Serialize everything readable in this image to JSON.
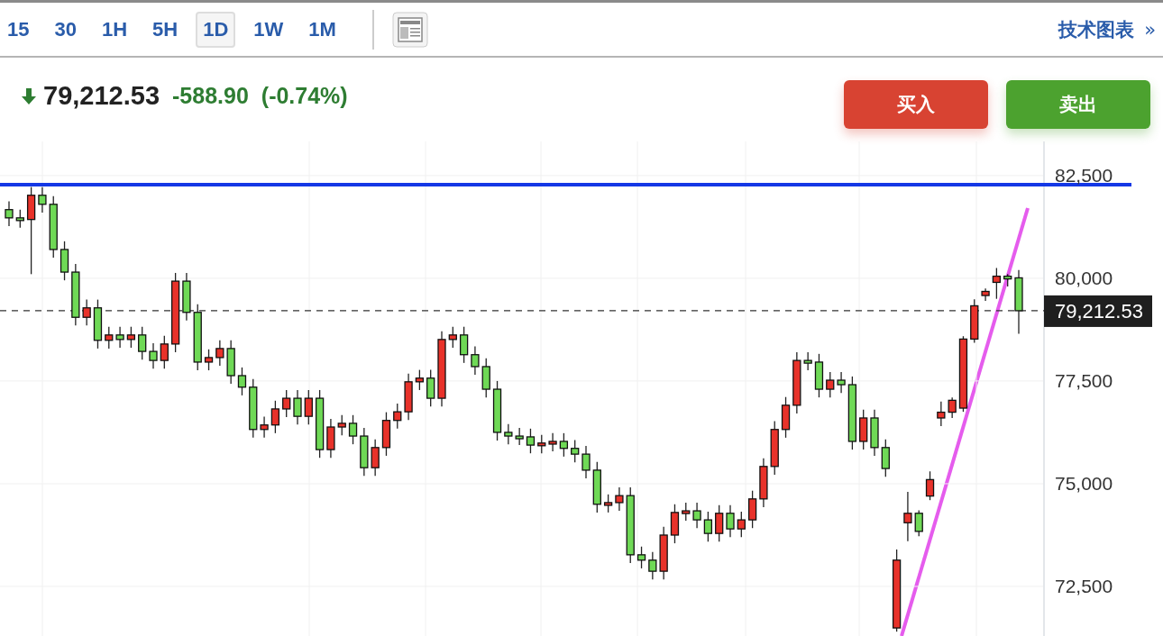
{
  "intervals": [
    {
      "label": "15",
      "selected": false
    },
    {
      "label": "30",
      "selected": false
    },
    {
      "label": "1H",
      "selected": false
    },
    {
      "label": "5H",
      "selected": false
    },
    {
      "label": "1D",
      "selected": true
    },
    {
      "label": "1W",
      "selected": false
    },
    {
      "label": "1M",
      "selected": false
    }
  ],
  "chart_link": {
    "label": "技术图表",
    "arrow": "»"
  },
  "quote": {
    "falling": true,
    "price": "79,212.53",
    "change": "-588.90",
    "change_percent": "(-0.74%)"
  },
  "buttons": [
    {
      "label": "买入",
      "kind": "buy"
    },
    {
      "label": "卖出",
      "kind": "sell"
    }
  ],
  "last_price_label": "79,212.53",
  "chart_data": {
    "type": "candlestick",
    "grid": true,
    "ylim": [
      71250,
      83330
    ],
    "yticks": [
      {
        "value": 72500,
        "label": "72,500"
      },
      {
        "value": 75000,
        "label": "75,000"
      },
      {
        "value": 77500,
        "label": "77,500"
      },
      {
        "value": 80000,
        "label": "80,000"
      },
      {
        "value": 82500,
        "label": "82,500"
      }
    ],
    "ohlc": [
      [
        81670,
        81870,
        81270,
        81470
      ],
      [
        81470,
        81670,
        81230,
        81430
      ],
      [
        81430,
        82220,
        80100,
        82020
      ],
      [
        82020,
        82220,
        81600,
        81800
      ],
      [
        81800,
        82000,
        80500,
        80700
      ],
      [
        80700,
        80900,
        79950,
        80150
      ],
      [
        80150,
        80350,
        78850,
        79050
      ],
      [
        79050,
        79480,
        78850,
        79280
      ],
      [
        79280,
        79480,
        78290,
        78490
      ],
      [
        78490,
        78820,
        78290,
        78620
      ],
      [
        78620,
        78820,
        78310,
        78510
      ],
      [
        78510,
        78820,
        78310,
        78620
      ],
      [
        78620,
        78820,
        78020,
        78220
      ],
      [
        78220,
        78420,
        77800,
        78000
      ],
      [
        78000,
        78600,
        77800,
        78400
      ],
      [
        78400,
        80130,
        78200,
        79930
      ],
      [
        79930,
        80130,
        78970,
        79170
      ],
      [
        79170,
        79370,
        77760,
        77960
      ],
      [
        77960,
        78270,
        77760,
        78070
      ],
      [
        78070,
        78490,
        77870,
        78290
      ],
      [
        78290,
        78490,
        77430,
        77630
      ],
      [
        77630,
        77830,
        77150,
        77350
      ],
      [
        77350,
        77550,
        76120,
        76320
      ],
      [
        76320,
        76630,
        76120,
        76430
      ],
      [
        76430,
        77020,
        76230,
        76820
      ],
      [
        76820,
        77280,
        76620,
        77080
      ],
      [
        77080,
        77280,
        76440,
        76640
      ],
      [
        76640,
        77280,
        76440,
        77080
      ],
      [
        77080,
        77280,
        75630,
        75830
      ],
      [
        75830,
        76580,
        75630,
        76380
      ],
      [
        76380,
        76670,
        76180,
        76470
      ],
      [
        76470,
        76670,
        75960,
        76160
      ],
      [
        76160,
        76360,
        75190,
        75390
      ],
      [
        75390,
        76080,
        75190,
        75880
      ],
      [
        75880,
        76740,
        75680,
        76540
      ],
      [
        76540,
        76950,
        76340,
        76750
      ],
      [
        76750,
        77680,
        76550,
        77480
      ],
      [
        77480,
        77770,
        77280,
        77570
      ],
      [
        77570,
        77770,
        76880,
        77080
      ],
      [
        77080,
        78710,
        76880,
        78510
      ],
      [
        78510,
        78820,
        78310,
        78620
      ],
      [
        78620,
        78820,
        77940,
        78140
      ],
      [
        78140,
        78340,
        77650,
        77850
      ],
      [
        77850,
        78050,
        77100,
        77300
      ],
      [
        77300,
        77500,
        76050,
        76250
      ],
      [
        76250,
        76450,
        75960,
        76160
      ],
      [
        76160,
        76360,
        75940,
        76140
      ],
      [
        76140,
        76340,
        75740,
        75940
      ],
      [
        75940,
        76190,
        75740,
        75990
      ],
      [
        75990,
        76230,
        75790,
        76030
      ],
      [
        76030,
        76230,
        75660,
        75860
      ],
      [
        75860,
        76060,
        75520,
        75720
      ],
      [
        75720,
        75920,
        75130,
        75330
      ],
      [
        75330,
        75530,
        74300,
        74500
      ],
      [
        74500,
        74740,
        74300,
        74540
      ],
      [
        74540,
        74910,
        74340,
        74710
      ],
      [
        74710,
        74910,
        73070,
        73270
      ],
      [
        73270,
        73470,
        72940,
        73140
      ],
      [
        73140,
        73340,
        72670,
        72870
      ],
      [
        72870,
        73950,
        72670,
        73750
      ],
      [
        73750,
        74500,
        73550,
        74300
      ],
      [
        74300,
        74540,
        74100,
        74340
      ],
      [
        74340,
        74540,
        73920,
        74120
      ],
      [
        74120,
        74320,
        73590,
        73790
      ],
      [
        73790,
        74480,
        73590,
        74280
      ],
      [
        74280,
        74480,
        73700,
        73900
      ],
      [
        73900,
        74320,
        73700,
        74120
      ],
      [
        74120,
        74830,
        73920,
        74630
      ],
      [
        74630,
        75620,
        74430,
        75420
      ],
      [
        75420,
        76520,
        75220,
        76320
      ],
      [
        76320,
        77110,
        76120,
        76910
      ],
      [
        76910,
        78200,
        76710,
        78000
      ],
      [
        78000,
        78200,
        77760,
        77960
      ],
      [
        77960,
        78160,
        77100,
        77300
      ],
      [
        77300,
        77720,
        77100,
        77520
      ],
      [
        77520,
        77720,
        77210,
        77410
      ],
      [
        77410,
        77610,
        75830,
        76030
      ],
      [
        76030,
        76800,
        75830,
        76600
      ],
      [
        76600,
        76800,
        75680,
        75880
      ],
      [
        75880,
        76080,
        75170,
        75370
      ],
      [
        71490,
        73400,
        71400,
        73140
      ],
      [
        74050,
        74800,
        73600,
        74280
      ],
      [
        74280,
        74350,
        73720,
        73840
      ],
      [
        74700,
        75300,
        74600,
        75100
      ],
      [
        76600,
        77000,
        76400,
        76740
      ],
      [
        76740,
        77100,
        76600,
        77030
      ],
      [
        76840,
        78590,
        76750,
        78520
      ],
      [
        78520,
        79490,
        78430,
        79330
      ],
      [
        79580,
        79750,
        79450,
        79680
      ],
      [
        79900,
        80250,
        79500,
        80050
      ],
      [
        80050,
        80100,
        79800,
        79990
      ],
      [
        80010,
        80200,
        78650,
        79210
      ]
    ],
    "ref_lines": [
      {
        "axis": "y",
        "value": 82280,
        "color": "#1438e6"
      },
      {
        "axis": "y",
        "value": 79210,
        "color": "#333333"
      }
    ]
  }
}
